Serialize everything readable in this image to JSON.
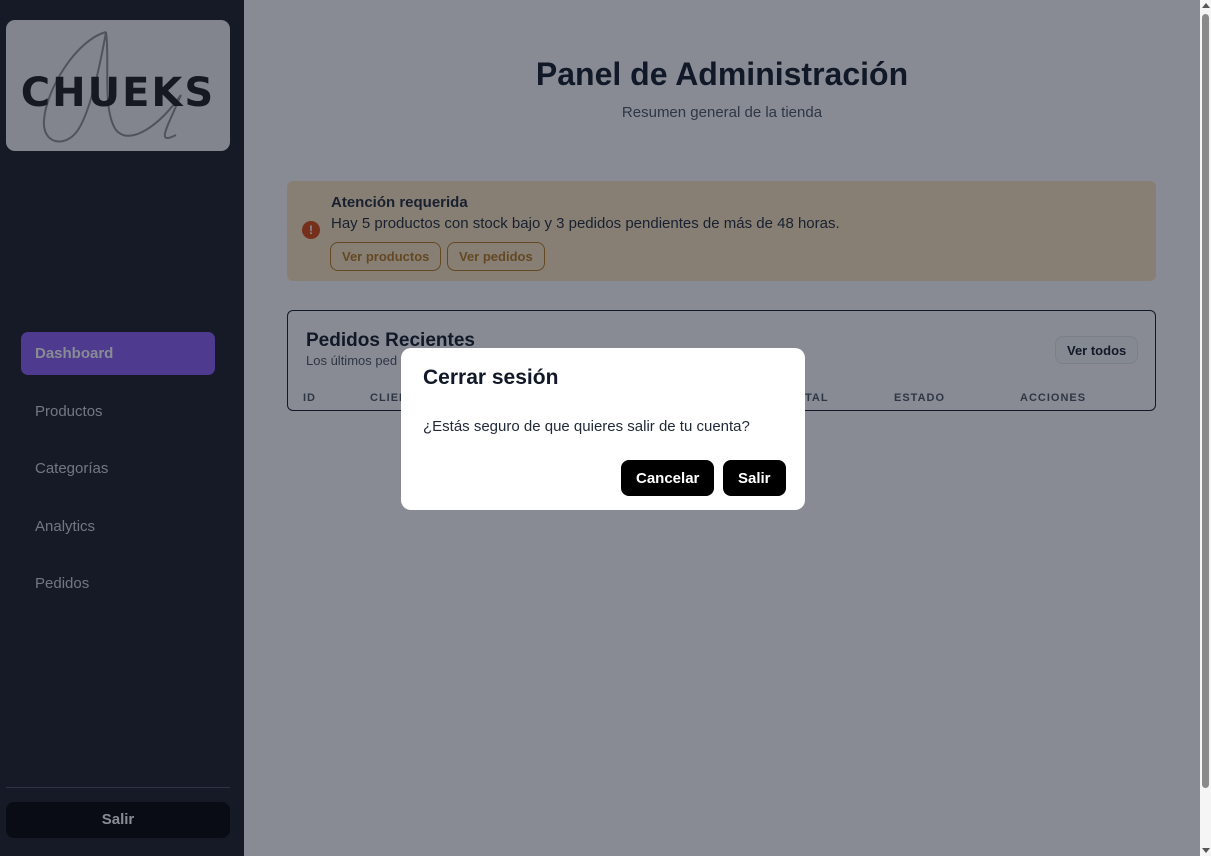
{
  "logo": {
    "brand": "CHUEKS"
  },
  "sidebar": {
    "items": [
      {
        "label": "Dashboard",
        "active": true
      },
      {
        "label": "Productos",
        "active": false
      },
      {
        "label": "Categorías",
        "active": false
      },
      {
        "label": "Analytics",
        "active": false
      },
      {
        "label": "Pedidos",
        "active": false
      }
    ],
    "logout_label": "Salir"
  },
  "header": {
    "title": "Panel de Administración",
    "subtitle": "Resumen general de la tienda"
  },
  "alert": {
    "title": "Atención requerida",
    "message": "Hay 5 productos con stock bajo y 3 pedidos pendientes de más de 48 horas.",
    "icon": "!",
    "buttons": [
      "Ver productos",
      "Ver pedidos"
    ]
  },
  "orders": {
    "title": "Pedidos Recientes",
    "subtitle": "Los últimos ped",
    "view_all_label": "Ver todos",
    "columns": [
      "ID",
      "CLIEN",
      "TAL",
      "ESTADO",
      "ACCIONES"
    ]
  },
  "modal": {
    "title": "Cerrar sesión",
    "message": "¿Estás seguro de que quieres salir de tu cuenta?",
    "cancel_label": "Cancelar",
    "confirm_label": "Salir"
  },
  "colors": {
    "sidebar_bg": "#1b1d27",
    "accent": "#8b5cf6",
    "alert_bg": "#fde7c0",
    "alert_accent": "#b7791f"
  }
}
